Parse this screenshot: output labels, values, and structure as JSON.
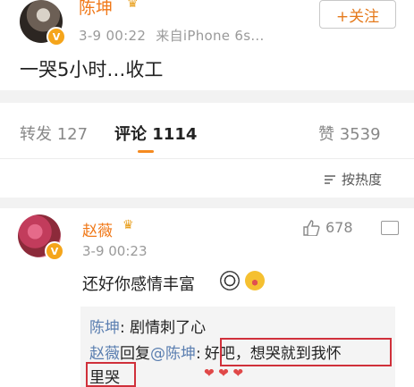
{
  "post": {
    "author": "陈坤",
    "time": "3-9 00:22",
    "source": "来自iPhone 6s...",
    "follow_label": "+关注",
    "text": "一哭5小时…收工",
    "badge": "V"
  },
  "tabs": {
    "repost_label": "转发 127",
    "comment_label": "评论 1114",
    "like_label": "赞 3539"
  },
  "sort": {
    "label": "按热度"
  },
  "comment": {
    "author": "赵薇",
    "time": "3-9 00:23",
    "likes": "678",
    "text": "还好你感情丰富",
    "badge": "V",
    "replies": [
      {
        "name": "陈坤",
        "text": ": 剧情刺了心"
      },
      {
        "name": "赵薇",
        "mid": "回复",
        "mention": "@陈坤",
        "sep": ":",
        "text": "好吧，想哭就到我怀"
      },
      {
        "text": "里哭"
      }
    ]
  },
  "colors": {
    "accent": "#f07818",
    "link": "#5a7eb0",
    "highlight": "#d0303a"
  }
}
